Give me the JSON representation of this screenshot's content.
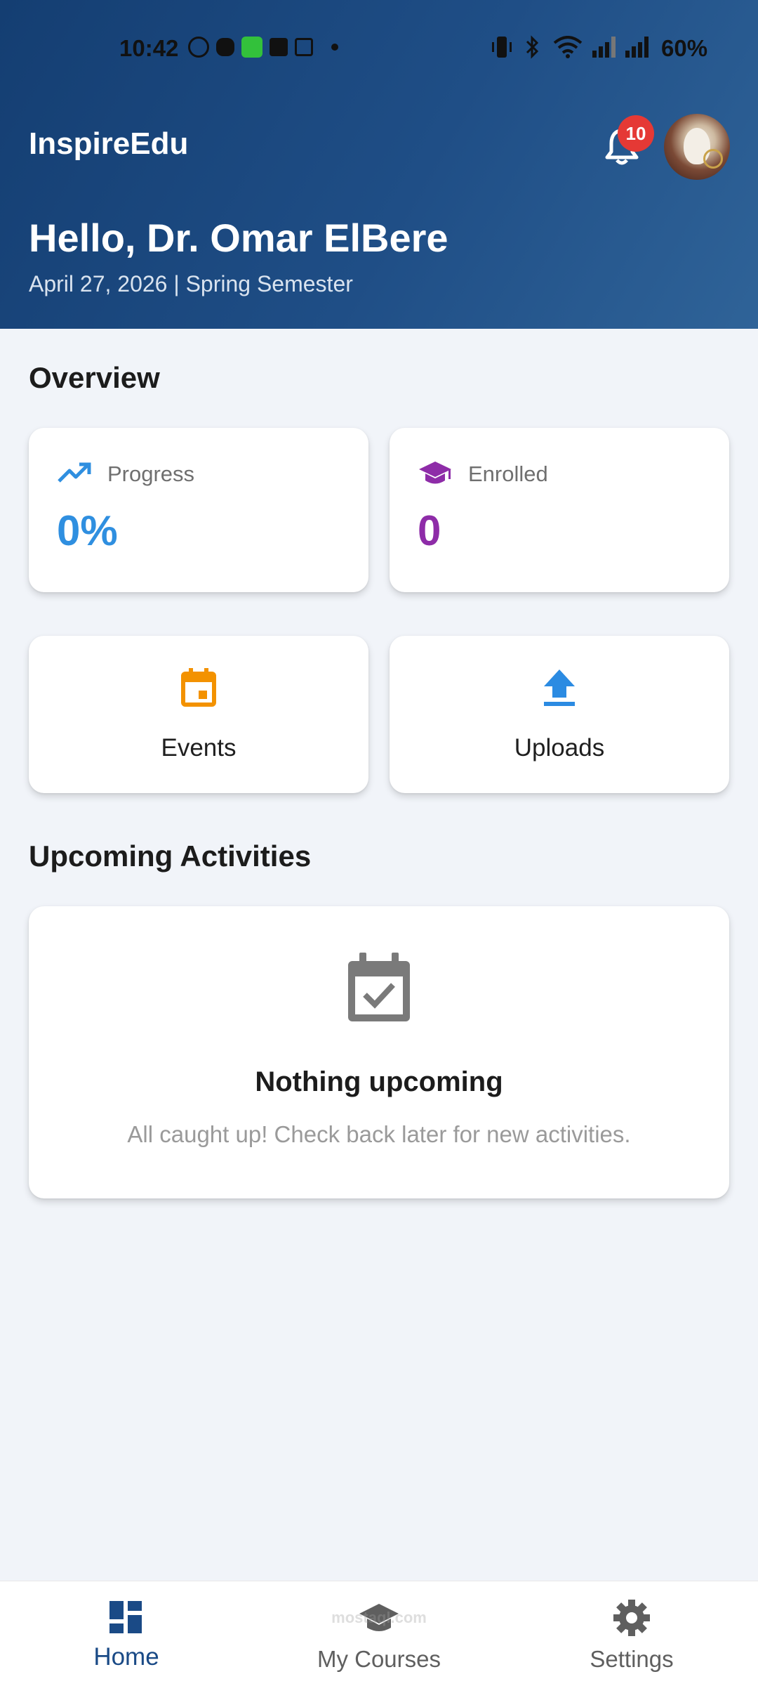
{
  "status_bar": {
    "time": "10:42",
    "battery": "60%"
  },
  "header": {
    "app_title": "InspireEdu",
    "notification_count": "10",
    "greeting": "Hello, Dr. Omar ElBere",
    "subline": "April 27, 2026 | Spring Semester",
    "gradient_colors": [
      "#143e72",
      "#2f6398"
    ]
  },
  "overview": {
    "title": "Overview",
    "stats": [
      {
        "label": "Progress",
        "value": "0%",
        "icon": "trending-up-icon",
        "color": "#2f8fe0"
      },
      {
        "label": "Enrolled",
        "value": "0",
        "icon": "graduation-cap-icon",
        "color": "#8e2ca8"
      }
    ],
    "actions": [
      {
        "label": "Events",
        "icon": "calendar-icon",
        "color": "#f39200"
      },
      {
        "label": "Uploads",
        "icon": "upload-icon",
        "color": "#2b8be2"
      }
    ]
  },
  "upcoming": {
    "title": "Upcoming Activities",
    "empty_title": "Nothing upcoming",
    "empty_text": "All caught up! Check back later for new activities.",
    "icon": "calendar-check-icon"
  },
  "bottom_nav": {
    "items": [
      {
        "label": "Home",
        "icon": "dashboard-icon",
        "active": true
      },
      {
        "label": "My Courses",
        "icon": "graduation-cap-icon",
        "active": false
      },
      {
        "label": "Settings",
        "icon": "gear-icon",
        "active": false
      }
    ],
    "watermark": "mostaql.com"
  }
}
